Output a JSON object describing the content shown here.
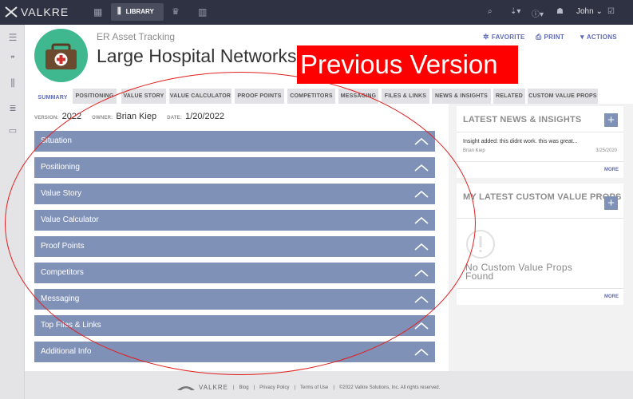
{
  "topbar": {
    "brand": "VALKRE",
    "library_label": "LIBRARY",
    "user_name": "John",
    "icons": [
      "grid-icon",
      "library-icon",
      "crown-icon",
      "chart-icon",
      "search-icon",
      "pin-icon",
      "help-icon",
      "network-icon",
      "checkbox-icon"
    ]
  },
  "header": {
    "eyebrow": "ER Asset Tracking",
    "title": "Large Hospital Networks",
    "favorite_label": "FAVORITE",
    "print_label": "PRINT",
    "actions_label": "ACTIONS"
  },
  "banner": {
    "text": "Previous Version",
    "color": "#ff0000"
  },
  "tabs": [
    {
      "label": "SUMMARY",
      "active": true
    },
    {
      "label": "POSITIONING"
    },
    {
      "label": "VALUE STORY"
    },
    {
      "label": "VALUE CALCULATOR"
    },
    {
      "label": "PROOF POINTS"
    },
    {
      "label": "COMPETITORS"
    },
    {
      "label": "MESSAGING"
    },
    {
      "label": "FILES & LINKS"
    },
    {
      "label": "NEWS & INSIGHTS"
    },
    {
      "label": "RELATED"
    },
    {
      "label": "CUSTOM VALUE PROPS"
    }
  ],
  "meta": {
    "version_label": "VERSION:",
    "version": "2022",
    "owner_label": "OWNER:",
    "owner": "Brian Kiep",
    "date_label": "DATE:",
    "date": "1/20/2022"
  },
  "sections": [
    "Situation",
    "Positioning",
    "Value Story",
    "Value Calculator",
    "Proof Points",
    "Competitors",
    "Messaging",
    "Top Files & Links",
    "Additional Info"
  ],
  "news": {
    "title": "LATEST NEWS & INSIGHTS",
    "item_text": "Insight added: this didnt work. this was great...",
    "item_author": "Brian Kiep",
    "item_date": "3/25/2020",
    "more": "MORE"
  },
  "custom_props": {
    "title": "MY LATEST CUSTOM VALUE PROPS",
    "empty_text": "No Custom Value Props Found",
    "more": "MORE"
  },
  "footer": {
    "brand": "VALKRE",
    "blog": "Blog",
    "privacy": "Privacy Policy",
    "terms": "Terms of Use",
    "copyright": "©2022 Valkre Solutions, Inc. All rights reserved."
  },
  "colors": {
    "navbar": "#2f3242",
    "accent": "#5f6bb7",
    "section_bar": "#8091b8",
    "avatar": "#3fb890",
    "annotation": "#e02020"
  }
}
